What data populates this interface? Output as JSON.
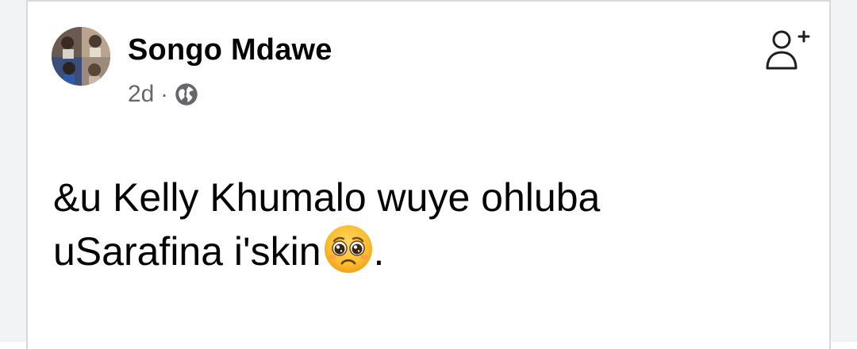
{
  "post": {
    "author": "Songo Mdawe",
    "time": "2d",
    "separator": "·",
    "privacy_icon": "globe-icon",
    "follow_icon": "add-friend-icon",
    "text_line1": "&u Kelly Khumalo wuye ohluba",
    "text_line2_prefix": "uSarafina i'skin",
    "text_line2_suffix": ".",
    "emoji": "pleading-face-emoji"
  },
  "colors": {
    "background": "#ffffff",
    "border": "#d8d9dc",
    "name": "#050505",
    "meta": "#65676b"
  }
}
